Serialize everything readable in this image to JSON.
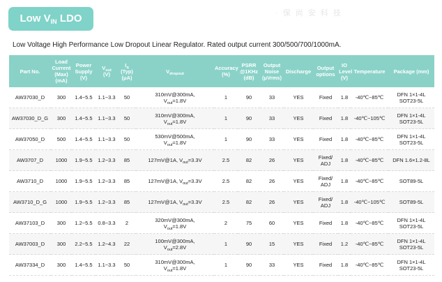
{
  "title": {
    "main": "Low V",
    "sub": "IN",
    "suffix": " LDO"
  },
  "subtitle": "Low Voltage High Performance Low Dropout Linear Regulator. Rated output current 300/500/700/1000mA.",
  "watermark": "· 保 尚 安 科 技",
  "colors": {
    "accent": "#7fd3c8",
    "header": "#8ad2c8"
  },
  "headers": {
    "part": "Part No.",
    "load": "Load Current (Max) (mA)",
    "power": "Power Supply (V)",
    "vout_main": "V",
    "vout_sub": "out",
    "vout_unit": "(V)",
    "iq_main": "I",
    "iq_sub": "q",
    "iq_unit": "(Typ) (μA)",
    "vdrop_main": "V",
    "vdrop_sub": "dropout",
    "accuracy": "Accuracy (%)",
    "psrr": "PSRR @1KHz (dB)",
    "noise": "Output Noise (μVrms)",
    "discharge": "Discharge",
    "options": "Output options",
    "io": "IO Level (V)",
    "temp": "Temperature",
    "package": "Package (mm)"
  },
  "rows": [
    {
      "part": "AW37030_D",
      "load": "300",
      "power": "1.4~5.5",
      "vout": "1.1~3.3",
      "iq": "50",
      "vd1": "310mV@300mA,",
      "vd2a": "V",
      "vd2s": "out",
      "vd2b": "=1.8V",
      "acc": "1",
      "psrr": "90",
      "noise": "33",
      "dis": "YES",
      "opt": "Fixed",
      "io": "1.8",
      "temp": "-40℃~85℃",
      "pkg": "DFN 1×1-4L SOT23-5L"
    },
    {
      "part": "AW37030_D_G",
      "load": "300",
      "power": "1.4~5.5",
      "vout": "1.1~3.3",
      "iq": "50",
      "vd1": "310mV@300mA,",
      "vd2a": "V",
      "vd2s": "out",
      "vd2b": "=1.8V",
      "acc": "1",
      "psrr": "90",
      "noise": "33",
      "dis": "YES",
      "opt": "Fixed",
      "io": "1.8",
      "temp": "-40℃~105℃",
      "pkg": "DFN 1×1-4L SOT23-5L"
    },
    {
      "part": "AW37050_D",
      "load": "500",
      "power": "1.4~5.5",
      "vout": "1.1~3.3",
      "iq": "50",
      "vd1": "530mV@500mA,",
      "vd2a": "V",
      "vd2s": "out",
      "vd2b": "=1.8V",
      "acc": "1",
      "psrr": "90",
      "noise": "33",
      "dis": "YES",
      "opt": "Fixed",
      "io": "1.8",
      "temp": "-40℃~85℃",
      "pkg": "DFN 1×1-4L SOT23-5L"
    },
    {
      "part": "AW3707_D",
      "load": "1000",
      "power": "1.9~5.5",
      "vout": "1.2~3.3",
      "iq": "85",
      "vd1": "127mV@1A, V",
      "vd1s": "out",
      "vd1b": "=3.3V",
      "acc": "2.5",
      "psrr": "82",
      "noise": "26",
      "dis": "YES",
      "opt": "Fixed/ ADJ",
      "io": "1.8",
      "temp": "-40℃~85℃",
      "pkg": "DFN 1.6×1.2-8L"
    },
    {
      "part": "AW3710_D",
      "load": "1000",
      "power": "1.9~5.5",
      "vout": "1.2~3.3",
      "iq": "85",
      "vd1": "127mV@1A, V",
      "vd1s": "out",
      "vd1b": "=3.3V",
      "acc": "2.5",
      "psrr": "82",
      "noise": "26",
      "dis": "YES",
      "opt": "Fixed/ ADJ",
      "io": "1.8",
      "temp": "-40℃~85℃",
      "pkg": "SOT89-5L"
    },
    {
      "part": "AW3710_D_G",
      "load": "1000",
      "power": "1.9~5.5",
      "vout": "1.2~3.3",
      "iq": "85",
      "vd1": "127mV@1A, V",
      "vd1s": "out",
      "vd1b": "=3.3V",
      "acc": "2.5",
      "psrr": "82",
      "noise": "26",
      "dis": "YES",
      "opt": "Fixed/ ADJ",
      "io": "1.8",
      "temp": "-40℃~105℃",
      "pkg": "SOT89-5L"
    },
    {
      "part": "AW37103_D",
      "load": "300",
      "power": "1.2~5.5",
      "vout": "0.8~3.3",
      "iq": "2",
      "vd1": "320mV@300mA,",
      "vd2a": "V",
      "vd2s": "out",
      "vd2b": "=1.8V",
      "acc": "2",
      "psrr": "75",
      "noise": "60",
      "dis": "YES",
      "opt": "Fixed",
      "io": "1.8",
      "temp": "-40℃~85℃",
      "pkg": "DFN 1×1-4L SOT23-5L"
    },
    {
      "part": "AW37003_D",
      "load": "300",
      "power": "2.2~5.5",
      "vout": "1.2~4.3",
      "iq": "22",
      "vd1": "100mV@300mA,",
      "vd2a": "V",
      "vd2s": "out",
      "vd2b": "=2.8V",
      "acc": "1",
      "psrr": "90",
      "noise": "15",
      "dis": "YES",
      "opt": "Fixed",
      "io": "1.2",
      "temp": "-40℃~85℃",
      "pkg": "DFN 1×1-4L SOT23-5L"
    },
    {
      "part": "AW37334_D",
      "load": "300",
      "power": "1.4~5.5",
      "vout": "1.1~3.3",
      "iq": "50",
      "vd1": "310mV@300mA,",
      "vd2a": "V",
      "vd2s": "out",
      "vd2b": "=1.8V",
      "acc": "1",
      "psrr": "90",
      "noise": "33",
      "dis": "YES",
      "opt": "Fixed",
      "io": "1.8",
      "temp": "-40℃~85℃",
      "pkg": "DFN 1×1-4L SOT23-5L"
    }
  ]
}
